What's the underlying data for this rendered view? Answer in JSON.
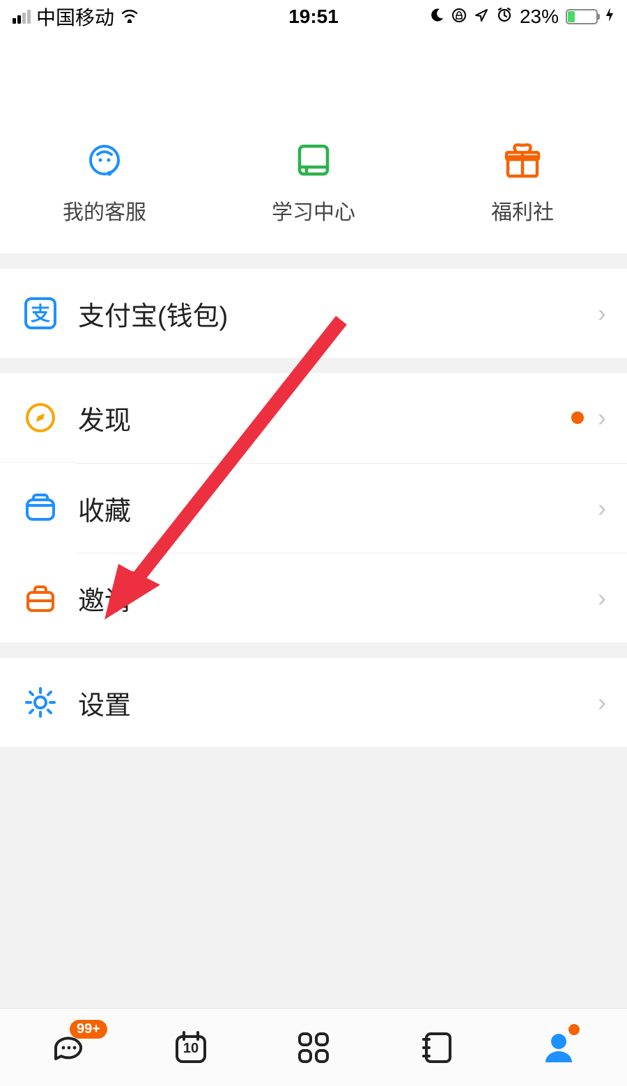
{
  "status": {
    "carrier": "中国移动",
    "time": "19:51",
    "battery_pct": "23%"
  },
  "quick": {
    "items": [
      {
        "label": "我的客服"
      },
      {
        "label": "学习中心"
      },
      {
        "label": "福利社"
      }
    ]
  },
  "rows": {
    "alipay": "支付宝(钱包)",
    "discover": "发现",
    "favorite": "收藏",
    "invite": "邀请",
    "settings": "设置"
  },
  "nav": {
    "messages_badge": "99+",
    "calendar_day": "10"
  },
  "colors": {
    "blue": "#1e90ff",
    "green": "#2bb24c",
    "orange": "#f56300",
    "amber": "#f7a500",
    "arrow": "#ed3040"
  }
}
